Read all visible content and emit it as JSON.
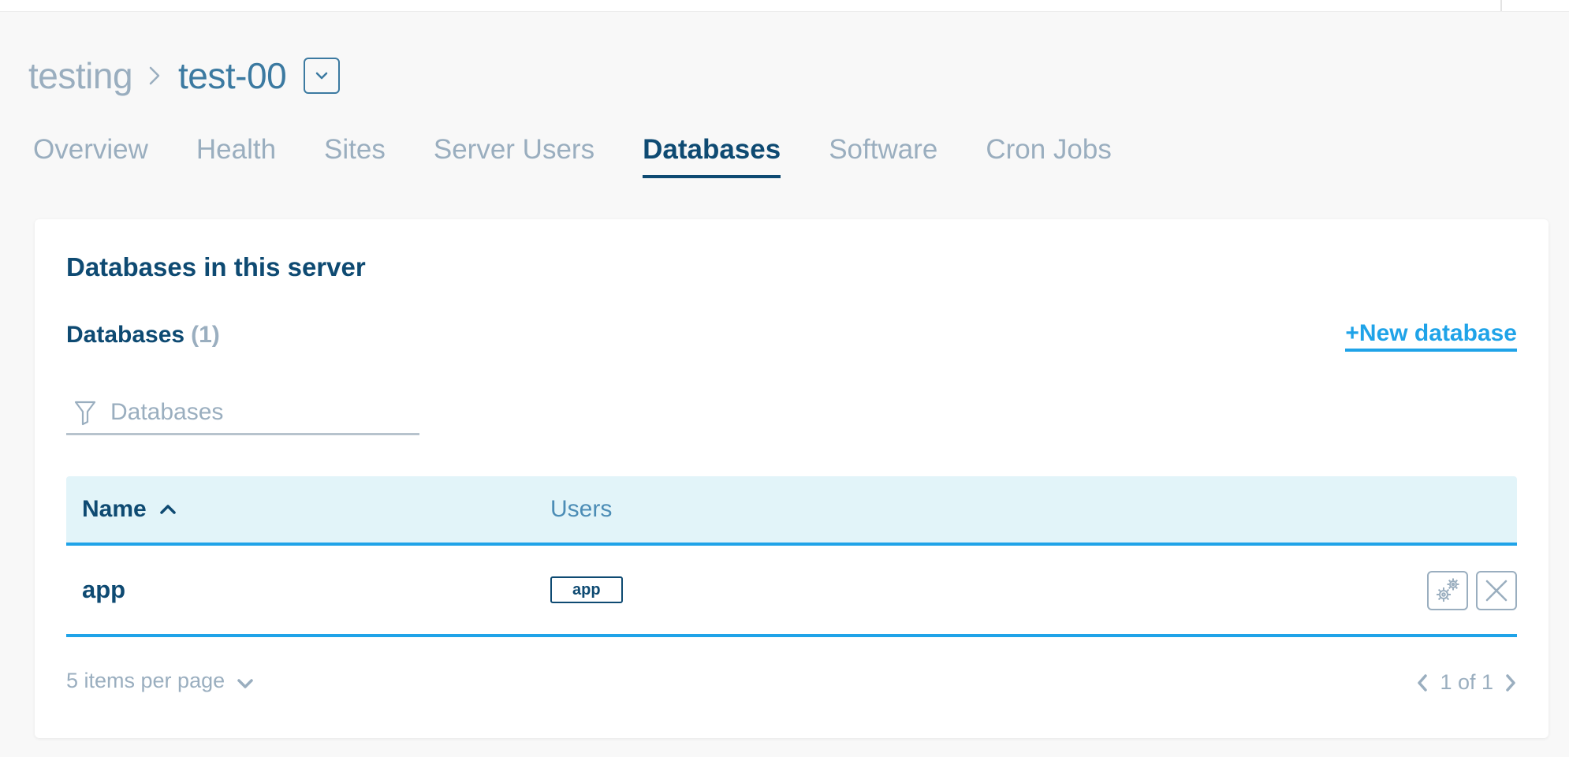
{
  "breadcrumb": {
    "parent": "testing",
    "separator": "›",
    "current": "test-00"
  },
  "tabs": [
    {
      "label": "Overview",
      "active": false
    },
    {
      "label": "Health",
      "active": false
    },
    {
      "label": "Sites",
      "active": false
    },
    {
      "label": "Server Users",
      "active": false
    },
    {
      "label": "Databases",
      "active": true
    },
    {
      "label": "Software",
      "active": false
    },
    {
      "label": "Cron Jobs",
      "active": false
    }
  ],
  "card": {
    "title": "Databases in this server",
    "section_label": "Databases",
    "count": "(1)",
    "new_button": "+New database",
    "filter_placeholder": "Databases"
  },
  "table": {
    "columns": {
      "name": "Name",
      "users": "Users"
    },
    "sort": {
      "column": "name",
      "direction": "ascending"
    },
    "rows": [
      {
        "name": "app",
        "users": [
          "app"
        ]
      }
    ]
  },
  "footer": {
    "per_page": "5 items per page",
    "page_info": "1 of 1"
  },
  "colors": {
    "primary": "#0e4a72",
    "accent": "#1fa3e8",
    "muted": "#9aaebf",
    "header_bg": "#e2f4f9",
    "page_bg": "#f8f8f8"
  },
  "icons": {
    "breadcrumb_dropdown": "chevron-down-icon",
    "filter": "filter-icon",
    "sort": "chevron-up-icon",
    "settings": "gears-icon",
    "delete": "close-icon",
    "per_page": "chevron-down-icon",
    "prev": "chevron-left-icon",
    "next": "chevron-right-icon"
  }
}
